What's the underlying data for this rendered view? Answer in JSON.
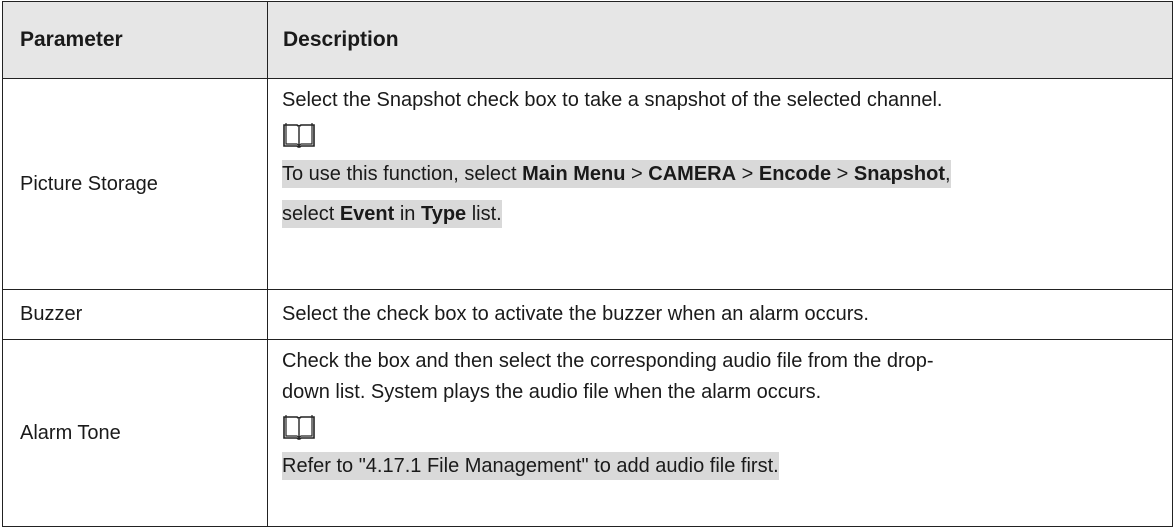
{
  "table": {
    "headers": {
      "parameter": "Parameter",
      "description": "Description"
    },
    "rows": [
      {
        "parameter": "Picture Storage",
        "description": "Select the Snapshot check box to take a snapshot of the selected channel.",
        "note_icon": "book-note-icon",
        "note": {
          "p1": "To use this function, select ",
          "b1": "Main Menu",
          "s1": " > ",
          "b2": "CAMERA",
          "s2": " > ",
          "b3": "Encode",
          "s3": " > ",
          "b4": "Snapshot",
          "s4": ",",
          "p2": "select ",
          "b5": "Event",
          "s5": " in ",
          "b6": "Type",
          "s6": " list."
        }
      },
      {
        "parameter": "Buzzer",
        "description": "Select the check box to activate the buzzer when an alarm occurs."
      },
      {
        "parameter": "Alarm Tone",
        "description_line1": "Check the box and then select the corresponding audio file from the drop-",
        "description_line2": "down list. System plays the audio file when the alarm occurs.",
        "note_icon": "book-note-icon",
        "note": "Refer to \"4.17.1 File Management\" to add audio file first."
      }
    ]
  },
  "colors": {
    "header_bg": "#e6e6e6",
    "note_highlight": "#d9d9d9",
    "border": "#222222"
  }
}
